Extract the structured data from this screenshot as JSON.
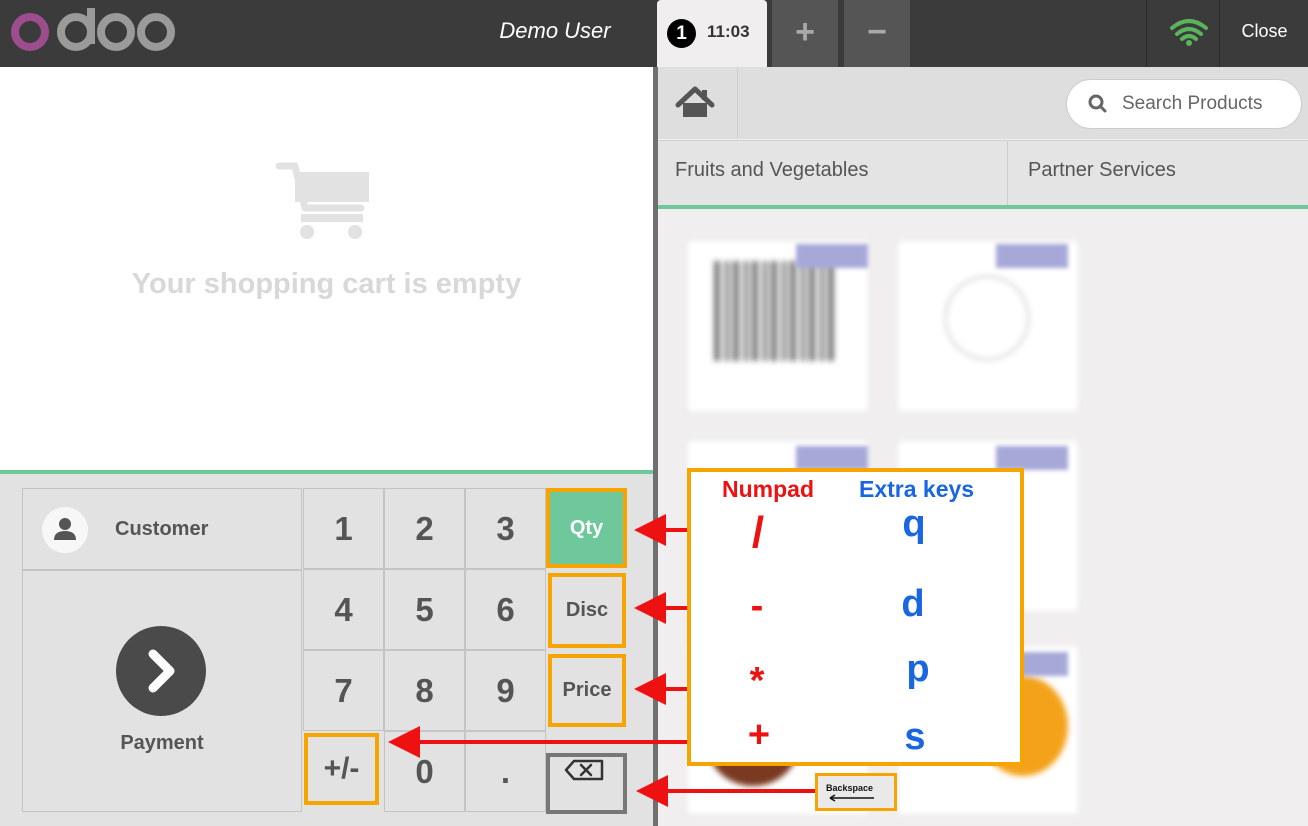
{
  "header": {
    "user": "Demo User",
    "order_number": "1",
    "order_time": "11:03",
    "add_order": "+",
    "remove_order": "−",
    "close": "Close"
  },
  "cart": {
    "empty_text": "Your shopping cart is empty"
  },
  "actions": {
    "customer": "Customer",
    "payment": "Payment"
  },
  "numpad": {
    "keys": [
      "1",
      "2",
      "3",
      "4",
      "5",
      "6",
      "7",
      "8",
      "9",
      "+/-",
      "0",
      "."
    ],
    "qty": "Qty",
    "disc": "Disc",
    "price": "Price"
  },
  "products": {
    "search_placeholder": "Search Products",
    "categories": [
      "Fruits and Vegetables",
      "Partner Services"
    ]
  },
  "legend": {
    "numpad_header": "Numpad",
    "extra_header": "Extra keys",
    "rows": [
      {
        "numpad": "/",
        "extra": "q"
      },
      {
        "numpad": "-",
        "extra": "d"
      },
      {
        "numpad": "*",
        "extra": "p"
      },
      {
        "numpad": "+",
        "extra": "s"
      }
    ],
    "backspace_label": "Backspace"
  },
  "colors": {
    "accent_green": "#6ec89b",
    "highlight_orange": "#f5a400",
    "arrow_red": "#ee1111",
    "extra_blue": "#1a66e0"
  },
  "icons": [
    "odoo-logo",
    "order-badge",
    "wifi-icon",
    "cart-icon",
    "customer-icon",
    "chevron-right-icon",
    "home-icon",
    "search-icon",
    "backspace-icon",
    "arrow-left-icon"
  ]
}
